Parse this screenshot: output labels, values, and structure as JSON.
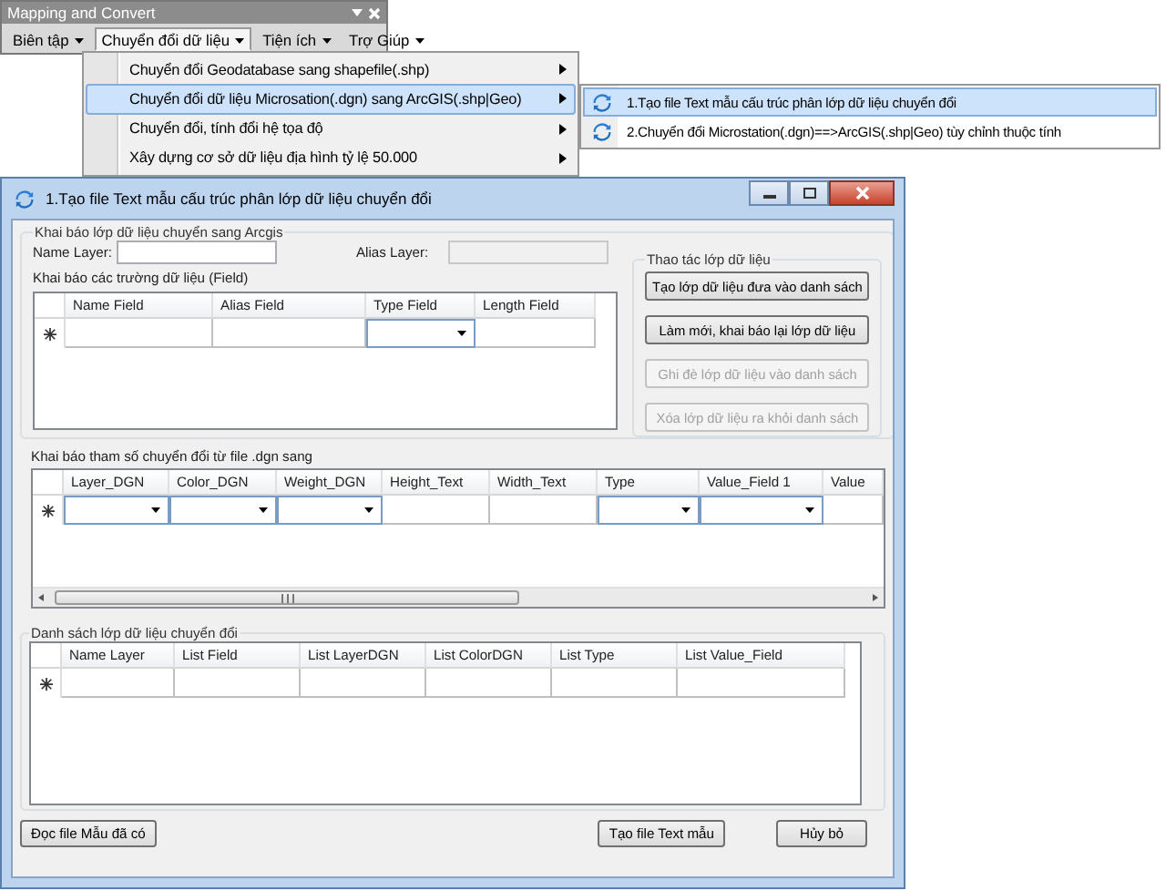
{
  "toolbar": {
    "title": "Mapping and Convert",
    "menus": [
      {
        "label": "Biên tập",
        "selected": false
      },
      {
        "label": "Chuyển đổi dữ liệu",
        "selected": true
      },
      {
        "label": "Tiện ích",
        "selected": false
      },
      {
        "label": "Trợ Giúp",
        "selected": false
      }
    ]
  },
  "dropdown": {
    "items": [
      {
        "label": "Chuyển đổi Geodatabase sang shapefile(.shp)",
        "selected": false
      },
      {
        "label": "Chuyển đổi dữ liệu Microsation(.dgn) sang ArcGIS(.shp|Geo)",
        "selected": true
      },
      {
        "label": "Chuyển đổi, tính đổi hệ tọa độ",
        "selected": false
      },
      {
        "label": "Xây dựng cơ sở dữ liệu địa hình tỷ lệ 50.000",
        "selected": false
      }
    ]
  },
  "submenu": {
    "items": [
      {
        "label": "1.Tạo file Text mẫu cấu trúc phân lớp dữ liệu chuyển đổi",
        "selected": true
      },
      {
        "label": "2.Chuyển đổi Microstation(.dgn)==>ArcGIS(.shp|Geo) tùy chỉnh thuộc tính",
        "selected": false
      }
    ]
  },
  "dialog": {
    "title": "1.Tạo file Text mẫu cấu trúc phân lớp dữ liệu chuyển đổi",
    "layer_group": {
      "legend": "Khai báo lớp dữ liệu chuyển sang Arcgis",
      "name_label": "Name Layer:",
      "name_field": {
        "disabled": false
      },
      "alias_label": "Alias Layer:",
      "alias_field": {
        "disabled": true
      },
      "fields_label": "Khai báo các trường dữ liệu (Field)",
      "fields_grid": {
        "columns": [
          {
            "label": "Name Field",
            "kind": "text"
          },
          {
            "label": "Alias Field",
            "kind": "text"
          },
          {
            "label": "Type Field",
            "kind": "combo"
          },
          {
            "label": "Length Field",
            "kind": "text"
          }
        ]
      }
    },
    "actions_group": {
      "legend": "Thao tác lớp dữ liệu",
      "buttons": [
        {
          "label": "Tạo lớp dữ liệu đưa vào danh sách",
          "disabled": false
        },
        {
          "label": "Làm mới, khai báo lại lớp dữ liệu",
          "disabled": false
        },
        {
          "label": "Ghi đè lớp dữ liệu vào danh sách",
          "disabled": true
        },
        {
          "label": "Xóa lớp dữ liệu ra khỏi danh sách",
          "disabled": true
        }
      ]
    },
    "params_label": "Khai báo tham số chuyển đổi từ file .dgn sang",
    "params_grid": {
      "columns": [
        {
          "label": "Layer_DGN",
          "kind": "combo"
        },
        {
          "label": "Color_DGN",
          "kind": "combo"
        },
        {
          "label": "Weight_DGN",
          "kind": "combo"
        },
        {
          "label": "Height_Text",
          "kind": "text"
        },
        {
          "label": "Width_Text",
          "kind": "text"
        },
        {
          "label": "Type",
          "kind": "combo"
        },
        {
          "label": "Value_Field 1",
          "kind": "combo"
        },
        {
          "label": "Value",
          "kind": "text"
        }
      ]
    },
    "list_group": {
      "legend": "Danh sách lớp dữ liệu chuyển đổi",
      "grid": {
        "columns": [
          {
            "label": "Name Layer",
            "kind": "text"
          },
          {
            "label": "List Field",
            "kind": "text"
          },
          {
            "label": "List LayerDGN",
            "kind": "text"
          },
          {
            "label": "List ColorDGN",
            "kind": "text"
          },
          {
            "label": "List Type",
            "kind": "text"
          },
          {
            "label": "List Value_Field",
            "kind": "text"
          }
        ]
      }
    },
    "buttons": [
      "Đọc file Mẫu đã có",
      "Tạo file Text mẫu",
      "Hủy bỏ"
    ]
  }
}
